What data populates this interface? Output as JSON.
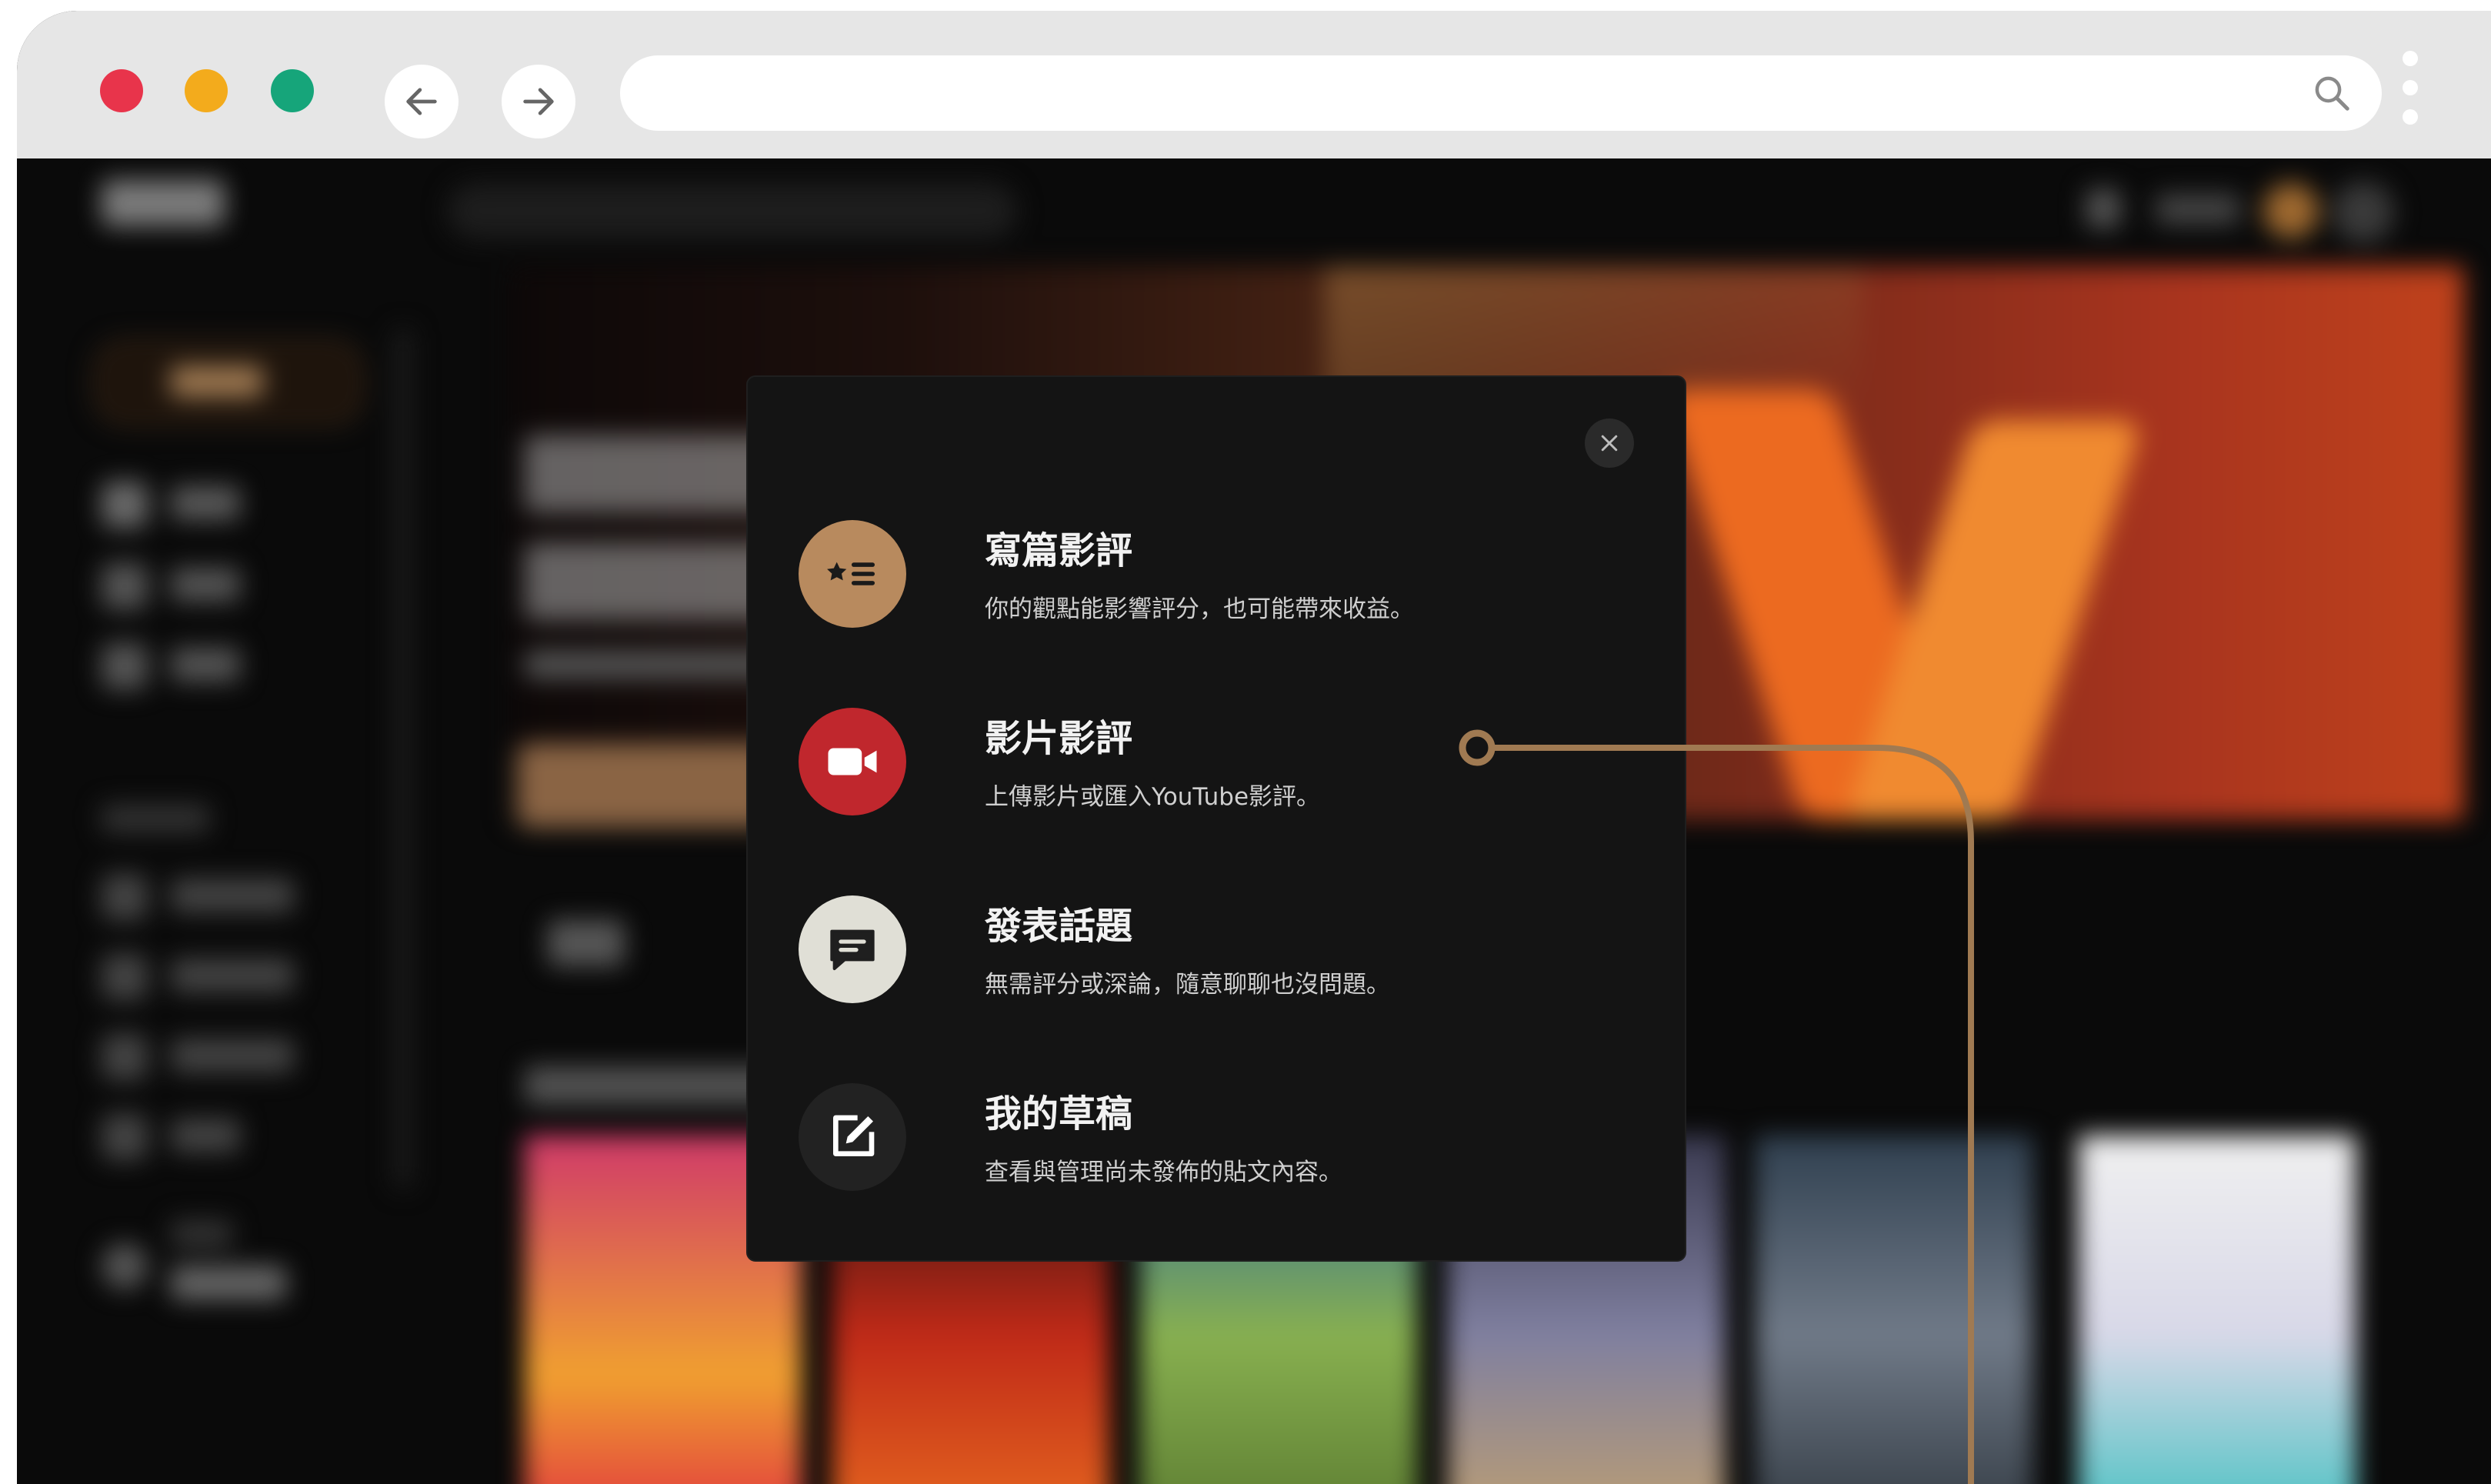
{
  "browser": {
    "url": "",
    "traffic_light_colors": [
      "#e8344b",
      "#f3ab1c",
      "#16a57a"
    ]
  },
  "modal": {
    "options": [
      {
        "title": "寫篇影評",
        "description": "你的觀點能影響評分，也可能帶來收益。",
        "icon": "star-list-icon",
        "icon_color": "#b88a5e"
      },
      {
        "title": "影片影評",
        "description": "上傳影片或匯入YouTube影評。",
        "icon": "video-camera-icon",
        "icon_color": "#c0272d"
      },
      {
        "title": "發表話題",
        "description": "無需評分或深論，隨意聊聊也沒問題。",
        "icon": "chat-bubble-icon",
        "icon_color": "#e0dfd6"
      },
      {
        "title": "我的草稿",
        "description": "查看與管理尚未發佈的貼文內容。",
        "icon": "edit-draft-icon",
        "icon_color": "#1f1f1f"
      }
    ],
    "close_icon": "close-icon"
  },
  "accent_color": "#a07a52"
}
